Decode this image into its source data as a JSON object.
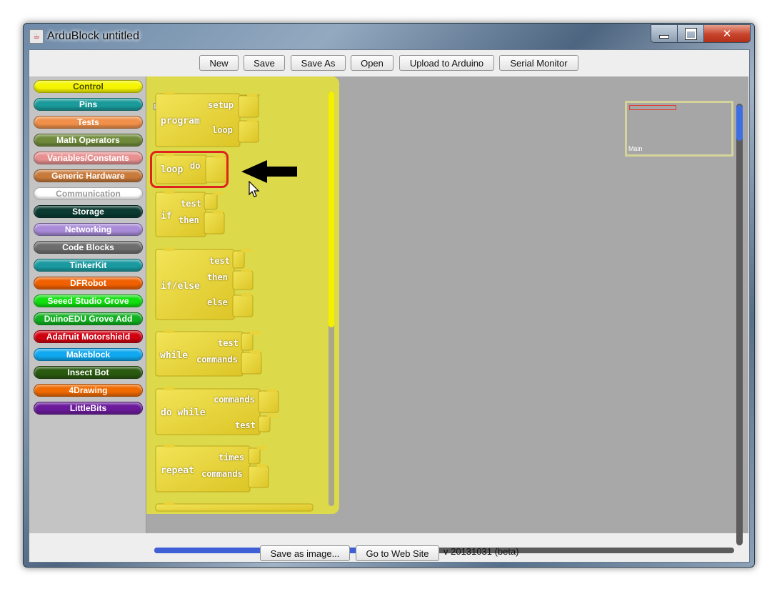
{
  "window": {
    "title": "ArduBlock untitled",
    "app_icon": "java-cup-icon",
    "controls": [
      "minimize-icon",
      "maximize-icon",
      "close-icon"
    ]
  },
  "toolbar": {
    "new": "New",
    "save": "Save",
    "save_as": "Save As",
    "open": "Open",
    "upload": "Upload to Arduino",
    "serial_monitor": "Serial Monitor"
  },
  "palette": {
    "categories": [
      {
        "label": "Control",
        "color": "#f5f500",
        "text": "#4a4a00"
      },
      {
        "label": "Pins",
        "color": "#1a9a9a",
        "text": "#ffffff"
      },
      {
        "label": "Tests",
        "color": "#f0904a",
        "text": "#ffffff"
      },
      {
        "label": "Math Operators",
        "color": "#6f8a3a",
        "text": "#ffffff"
      },
      {
        "label": "Variables/Constants",
        "color": "#e89090",
        "text": "#ffffff"
      },
      {
        "label": "Generic Hardware",
        "color": "#c87a3a",
        "text": "#ffffff"
      },
      {
        "label": "Communication",
        "color": "#ffffff",
        "text": "#9a9a9a"
      },
      {
        "label": "Storage",
        "color": "#0a3a32",
        "text": "#ffffff"
      },
      {
        "label": "Networking",
        "color": "#a88ad8",
        "text": "#ffffff"
      },
      {
        "label": "Code Blocks",
        "color": "#6e6e6e",
        "text": "#ffffff"
      },
      {
        "label": "TinkerKit",
        "color": "#1a9aa0",
        "text": "#ffffff"
      },
      {
        "label": "DFRobot",
        "color": "#f06000",
        "text": "#ffffff"
      },
      {
        "label": "Seeed Studio Grove",
        "color": "#10e010",
        "text": "#ffffff"
      },
      {
        "label": "DuinoEDU Grove Add",
        "color": "#10b020",
        "text": "#ffffff"
      },
      {
        "label": "Adafruit Motorshield",
        "color": "#d00010",
        "text": "#ffffff"
      },
      {
        "label": "Makeblock",
        "color": "#10a8f0",
        "text": "#ffffff"
      },
      {
        "label": "Insect Bot",
        "color": "#2a5a10",
        "text": "#ffffff"
      },
      {
        "label": "4Drawing",
        "color": "#f06a00",
        "text": "#ffffff"
      },
      {
        "label": "LittleBits",
        "color": "#6a1a9a",
        "text": "#ffffff"
      }
    ]
  },
  "blocks": {
    "program": {
      "name": "program",
      "setup": "setup",
      "loop": "loop"
    },
    "loop": {
      "name": "loop",
      "do": "do"
    },
    "if": {
      "name": "if",
      "test": "test",
      "then": "then"
    },
    "ifelse": {
      "name": "if/else",
      "test": "test",
      "then": "then",
      "else": "else"
    },
    "while": {
      "name": "while",
      "test": "test",
      "commands": "commands"
    },
    "dowhile": {
      "name": "do while",
      "commands": "commands",
      "test": "test"
    },
    "repeat": {
      "name": "repeat",
      "times": "times",
      "commands": "commands"
    }
  },
  "minimap": {
    "label": "Main"
  },
  "status": {
    "save_image": "Save as image...",
    "website": "Go to Web Site",
    "version": "v 20131031 (beta)"
  },
  "colors": {
    "block": "#e8d43a",
    "drawer": "#dcd94a",
    "canvas": "#a8a8a8",
    "highlight": "#e0221c"
  }
}
